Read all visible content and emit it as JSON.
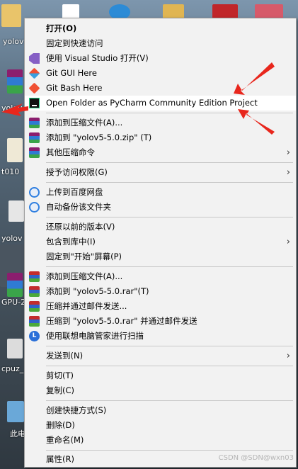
{
  "desktop": {
    "labels": [
      "yolov",
      "yolov",
      "t010",
      "yolov",
      "GPU-2",
      "cpuz_",
      "此电"
    ]
  },
  "menu": {
    "items": [
      {
        "label": "打开(O)",
        "bold": true
      },
      {
        "label": "固定到快速访问"
      },
      {
        "label": "使用 Visual Studio 打开(V)",
        "icon": "visual-studio-icon"
      },
      {
        "label": "Git GUI Here",
        "icon": "git-gui-icon"
      },
      {
        "label": "Git Bash Here",
        "icon": "git-bash-icon"
      },
      {
        "label": "Open Folder as PyCharm Community Edition Project",
        "icon": "pycharm-icon",
        "highlighted": true
      },
      {
        "label": "添加到压缩文件(A)...",
        "icon": "archive-icon"
      },
      {
        "label": "添加到 \"yolov5-5.0.zip\" (T)",
        "icon": "archive-icon"
      },
      {
        "label": "其他压缩命令",
        "icon": "archive-icon",
        "submenu": true
      },
      {
        "label": "授予访问权限(G)",
        "submenu": true
      },
      {
        "label": "上传到百度网盘",
        "icon": "baidu-netdisk-icon"
      },
      {
        "label": "自动备份该文件夹",
        "icon": "baidu-netdisk-icon"
      },
      {
        "label": "还原以前的版本(V)"
      },
      {
        "label": "包含到库中(I)",
        "submenu": true
      },
      {
        "label": "固定到\"开始\"屏幕(P)"
      },
      {
        "label": "添加到压缩文件(A)...",
        "icon": "winrar-icon"
      },
      {
        "label": "添加到 \"yolov5-5.0.rar\"(T)",
        "icon": "winrar-icon"
      },
      {
        "label": "压缩并通过邮件发送...",
        "icon": "winrar-icon"
      },
      {
        "label": "压缩到 \"yolov5-5.0.rar\" 并通过邮件发送",
        "icon": "winrar-icon"
      },
      {
        "label": "使用联想电脑管家进行扫描",
        "icon": "lenovo-icon"
      },
      {
        "label": "发送到(N)",
        "submenu": true
      },
      {
        "label": "剪切(T)"
      },
      {
        "label": "复制(C)"
      },
      {
        "label": "创建快捷方式(S)"
      },
      {
        "label": "删除(D)"
      },
      {
        "label": "重命名(M)"
      },
      {
        "label": "属性(R)"
      }
    ],
    "submenu_arrow": "›"
  },
  "lenovo_glyph": "L",
  "watermark": "CSDN @SDN@wxn03",
  "colors": {
    "menu_bg": "#f2f2f2",
    "highlight": "#ffffff",
    "annotation_arrow": "#e8261c"
  }
}
